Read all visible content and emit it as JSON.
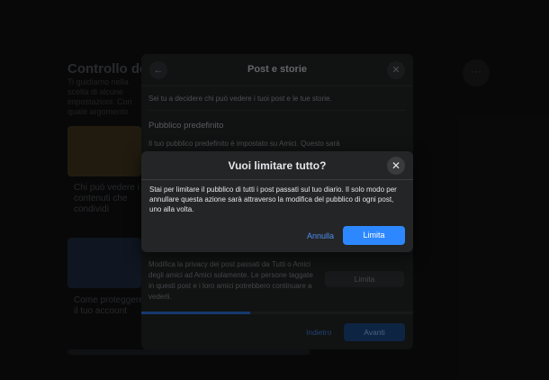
{
  "background": {
    "page_title": "Controllo dell",
    "page_subtitle": "Ti guidiamo nella scelta di alcune impostazioni. Con quale argomento",
    "cards": [
      {
        "label": "Chi può vedere i contenuti che condividi"
      },
      {
        "label": "Come proteggere il tuo account"
      }
    ],
    "more_icon": "ellipsis-icon",
    "more_glyph": "···"
  },
  "panel": {
    "title": "Post e storie",
    "back_icon": "arrow-left-icon",
    "back_glyph": "←",
    "close_icon": "close-icon",
    "close_glyph": "✕",
    "description": "Sei tu a decidere chi può vedere i tuoi post e le tue storie.",
    "section_title": "Pubblico predefinito",
    "section_text": "Il tuo pubblico predefinito è impostato su Amici. Questo sarà",
    "limit_text": "Modifica la privacy dei post passati da Tutti o Amici degli amici ad Amici solamente. Le persone taggate in questi post e i loro amici potrebbero continuare a vederli.",
    "limit_button": "Limita",
    "progress": 0.4,
    "back_button": "Indietro",
    "next_button": "Avanti"
  },
  "dialog": {
    "title": "Vuoi limitare tutto?",
    "close_icon": "close-icon",
    "close_glyph": "✕",
    "body": "Stai per limitare il pubblico di tutti i post passati sul tuo diario. Il solo modo per annullare questa azione sarà attraverso la modifica del pubblico di ogni post, uno alla volta.",
    "cancel_button": "Annulla",
    "confirm_button": "Limita"
  },
  "colors": {
    "accent": "#2d88ff",
    "link": "#4b8ef0",
    "dialog_bg": "#242526",
    "page_bg": "#0c0c0d"
  }
}
